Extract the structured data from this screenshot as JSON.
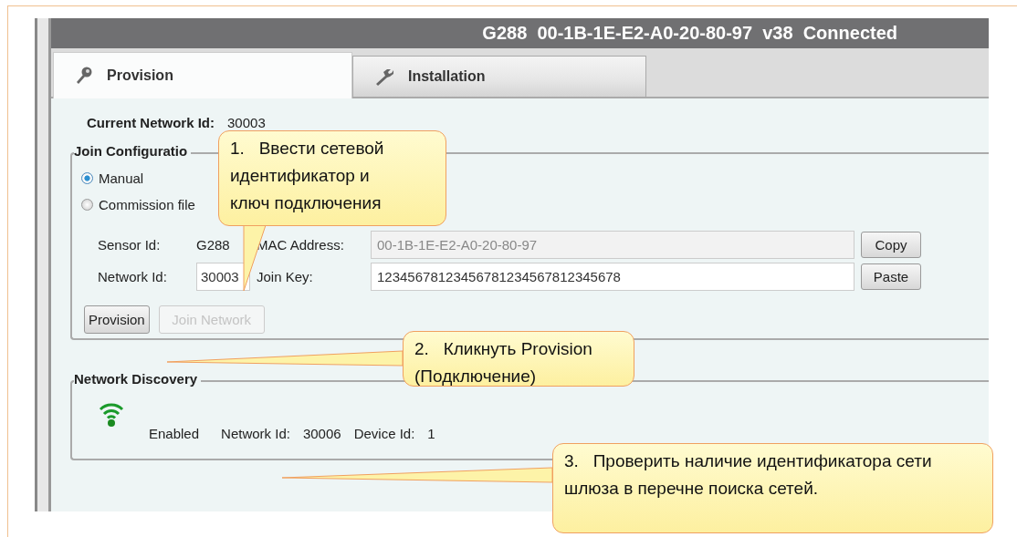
{
  "window": {
    "title": "G288  00-1B-1E-E2-A0-20-80-97  v38  Connected"
  },
  "tabs": [
    {
      "label": "Provision",
      "selected": true
    },
    {
      "label": "Installation",
      "selected": false
    }
  ],
  "current_network": {
    "label": "Current Network Id:",
    "value": "30003"
  },
  "join_configuration": {
    "title": "Join Configuratio",
    "options": [
      {
        "label": "Manual",
        "selected": true
      },
      {
        "label": "Commission file",
        "selected": false
      }
    ],
    "rows": [
      {
        "label": "Sensor Id:",
        "kind": "text",
        "value": "G288",
        "field_label": "MAC Address:",
        "field_value": "00-1B-1E-E2-A0-20-80-97",
        "field_disabled": true,
        "button": "Copy"
      },
      {
        "label": "Network Id:",
        "kind": "input",
        "value": "30003",
        "field_label": "Join Key:",
        "field_value": "12345678123456781234567812345678",
        "field_disabled": false,
        "button": "Paste"
      }
    ],
    "buttons": [
      {
        "label": "Provision",
        "disabled": false
      },
      {
        "label": "Join Network",
        "disabled": true
      }
    ]
  },
  "network_discovery": {
    "title": "Network Discovery",
    "status": "Enabled",
    "items": [
      {
        "label": "Network Id:",
        "value": "30006"
      },
      {
        "label": "Device Id:",
        "value": "1"
      }
    ]
  },
  "callouts": [
    {
      "text": "1.   Ввести сетевой идентификатор и ключ подключения"
    },
    {
      "text": "2.   Кликнуть Provision (Подключение)"
    },
    {
      "text": "3.   Проверить наличие идентификатора сети шлюза в перечне поиска сетей."
    }
  ]
}
